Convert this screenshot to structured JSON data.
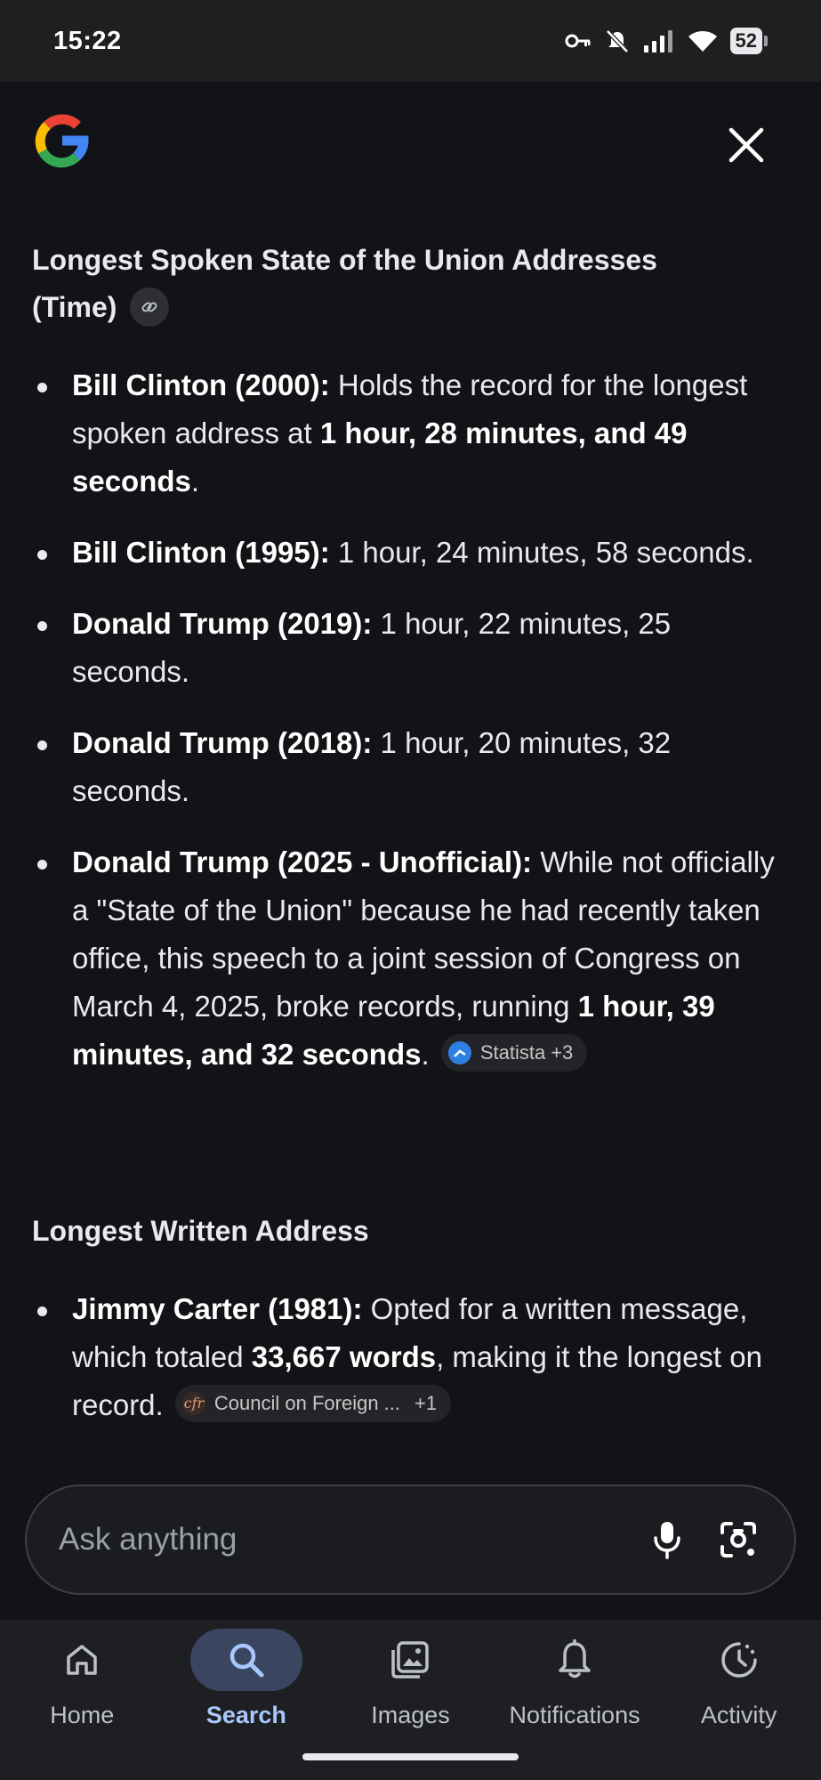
{
  "status_bar": {
    "time": "15:22",
    "battery": "52",
    "icons": [
      "vpn-key-icon",
      "mute-icon",
      "signal-icon",
      "wifi-icon",
      "battery-icon"
    ]
  },
  "header": {
    "logo": "google-g-logo",
    "close_icon": "close-icon"
  },
  "section1": {
    "title": "Longest Spoken State of the Union Addresses (Time)",
    "link_icon": "link-icon",
    "items": [
      {
        "bold": "Bill Clinton (2000):",
        "text": " Holds the record for the longest spoken address at ",
        "bold2": "1 hour, 28 minutes, and 49 seconds",
        "text2": "."
      },
      {
        "bold": "Bill Clinton (1995):",
        "text": " 1 hour, 24 minutes, 58 seconds."
      },
      {
        "bold": "Donald Trump (2019):",
        "text": " 1 hour, 22 minutes, 25 seconds."
      },
      {
        "bold": "Donald Trump (2018):",
        "text": " 1 hour, 20 minutes, 32 seconds."
      },
      {
        "bold": "Donald Trump (2025 - Unofficial):",
        "text": " While not officially a \"State of the Union\" because he had recently taken office, this speech to a joint session of Congress on March 4, 2025, broke records, running ",
        "bold2": "1 hour, 39 minutes, and 32 seconds",
        "text2": ".",
        "source": {
          "name": "Statista",
          "more": "+3"
        }
      }
    ]
  },
  "section2": {
    "title": "Longest Written Address",
    "items": [
      {
        "bold": "Jimmy Carter (1981):",
        "text": " Opted for a written message, which totaled ",
        "bold2": "33,667 words",
        "text2": ", making it the longest on record.",
        "source": {
          "name": "Council on Foreign ...",
          "more": "+1"
        }
      }
    ]
  },
  "ask_bar": {
    "placeholder": "Ask anything",
    "mic_icon": "microphone-icon",
    "lens_icon": "camera-lens-icon"
  },
  "bottom_nav": {
    "items": [
      {
        "label": "Home",
        "icon": "home-icon",
        "active": false
      },
      {
        "label": "Search",
        "icon": "search-icon",
        "active": true
      },
      {
        "label": "Images",
        "icon": "images-icon",
        "active": false
      },
      {
        "label": "Notifications",
        "icon": "bell-icon",
        "active": false
      },
      {
        "label": "Activity",
        "icon": "activity-icon",
        "active": false
      }
    ]
  },
  "colors": {
    "background": "#121317",
    "active_nav": "#a8c7fa",
    "active_pill": "#3a4660"
  }
}
